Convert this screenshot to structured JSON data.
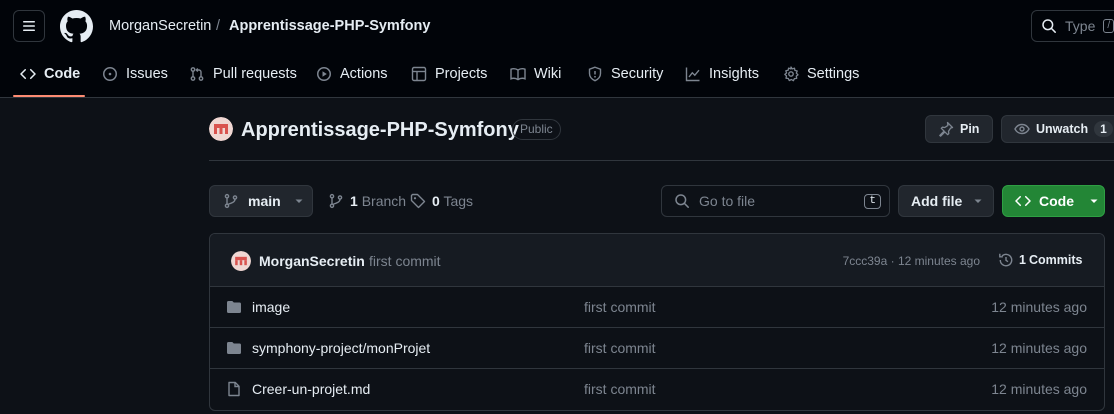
{
  "header": {
    "owner": "MorganSecretin",
    "separator": "/",
    "repo": "Apprentissage-PHP-Symfony",
    "search_placeholder": "Type",
    "search_key": "/"
  },
  "nav": {
    "tabs": [
      {
        "label": "Code",
        "icon": "code-icon",
        "active": true
      },
      {
        "label": "Issues",
        "icon": "issue-icon"
      },
      {
        "label": "Pull requests",
        "icon": "pull-request-icon"
      },
      {
        "label": "Actions",
        "icon": "play-icon"
      },
      {
        "label": "Projects",
        "icon": "table-icon"
      },
      {
        "label": "Wiki",
        "icon": "book-icon"
      },
      {
        "label": "Security",
        "icon": "shield-icon"
      },
      {
        "label": "Insights",
        "icon": "graph-icon"
      },
      {
        "label": "Settings",
        "icon": "gear-icon"
      }
    ]
  },
  "repo_header": {
    "title": "Apprentissage-PHP-Symfony",
    "visibility": "Public",
    "pin_label": "Pin",
    "unwatch_label": "Unwatch",
    "watch_count": "1"
  },
  "controls": {
    "branch": "main",
    "branch_count": "1",
    "branch_label": "Branch",
    "tag_count": "0",
    "tag_label": "Tags",
    "goto_placeholder": "Go to file",
    "goto_key": "t",
    "add_file_label": "Add file",
    "code_label": "Code"
  },
  "latest_commit": {
    "author": "MorganSecretin",
    "message": "first commit",
    "hash_time": "7ccc39a · 12 minutes ago",
    "commits_count": "1",
    "commits_label": "Commits"
  },
  "files": [
    {
      "name": "image",
      "type": "folder",
      "message": "first commit",
      "time": "12 minutes ago"
    },
    {
      "name": "symphony-project/monProjet",
      "type": "folder",
      "message": "first commit",
      "time": "12 minutes ago"
    },
    {
      "name": "Creer-un-projet.md",
      "type": "file",
      "message": "first commit",
      "time": "12 minutes ago"
    }
  ],
  "colors": {
    "background": "#0d1117",
    "header_bg": "#010409",
    "border": "#30363d",
    "accent_underline": "#fd8c73",
    "code_button": "#238636",
    "muted_text": "#7d8590"
  }
}
